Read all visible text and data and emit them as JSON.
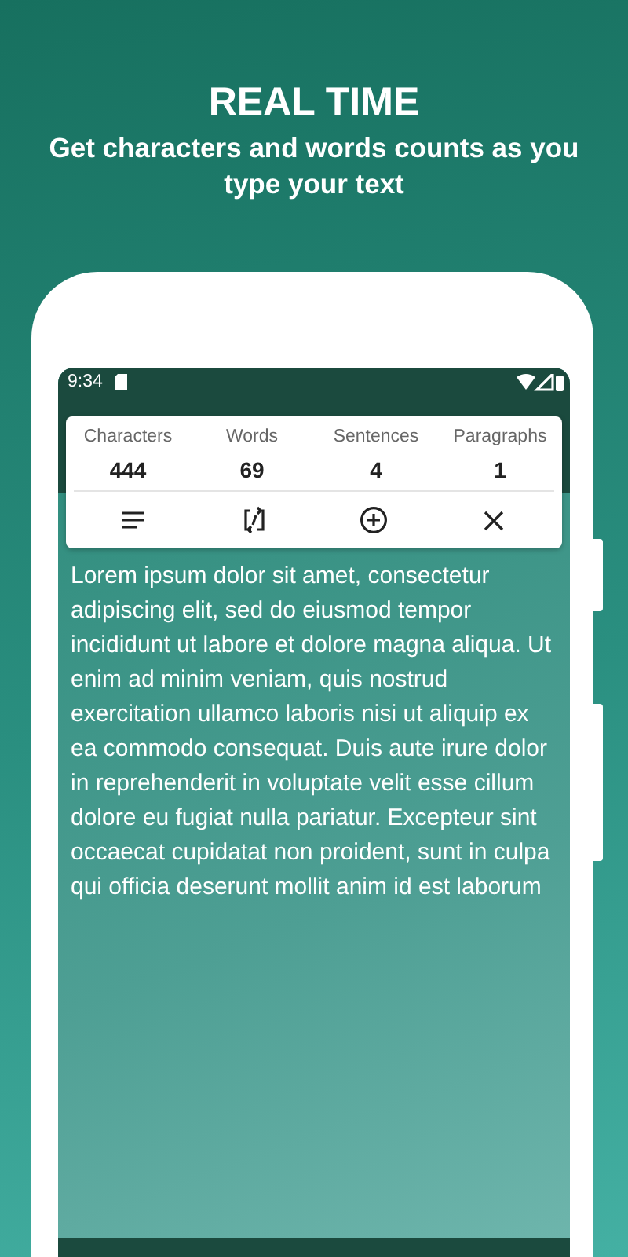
{
  "headline": "REAL TIME",
  "subheadline": "Get characters and words counts as you type your text",
  "status_bar": {
    "time": "9:34"
  },
  "stats": [
    {
      "label": "Characters",
      "value": "444"
    },
    {
      "label": "Words",
      "value": "69"
    },
    {
      "label": "Sentences",
      "value": "4"
    },
    {
      "label": "Paragraphs",
      "value": "1"
    }
  ],
  "toolbar": [
    {
      "kind": "menu"
    },
    {
      "kind": "swap"
    },
    {
      "kind": "add"
    },
    {
      "kind": "close"
    }
  ],
  "text": "Lorem ipsum dolor sit amet, consectetur adipiscing elit, sed do eiusmod tempor incididunt ut labore et dolore magna aliqua. Ut enim ad minim veniam, quis nostrud exercitation ullamco laboris nisi ut aliquip ex ea commodo consequat. Duis aute irure dolor in reprehenderit in voluptate velit esse cillum dolore eu fugiat nulla pariatur. Excepteur sint occaecat cupidatat non proident, sunt in culpa qui officia deserunt mollit anim id est laborum"
}
